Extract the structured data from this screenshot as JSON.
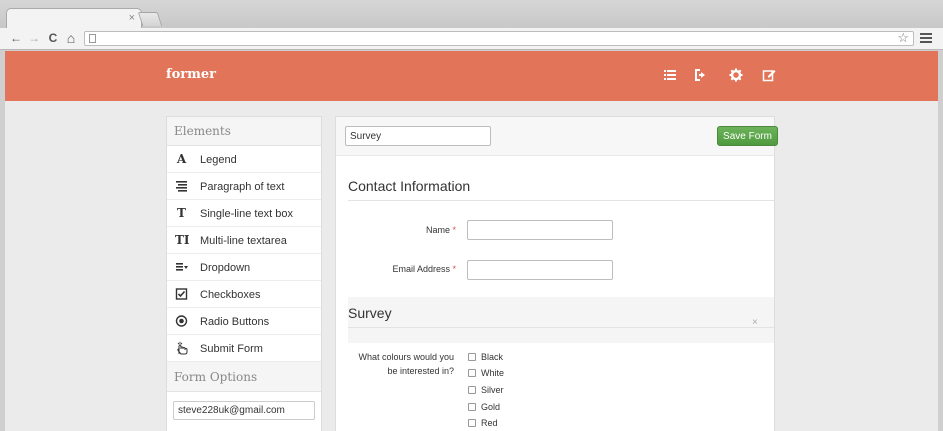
{
  "browser": {
    "tab_close": "×",
    "nav": {
      "back": "←",
      "forward": "→",
      "reload": "C",
      "home": "⌂"
    },
    "star": "☆"
  },
  "app": {
    "brand": "former",
    "header_icons": [
      "list-icon",
      "sign-out-icon",
      "gear-icon",
      "edit-icon"
    ],
    "accent_color": "#e27559"
  },
  "sidebar": {
    "elements_heading": "Elements",
    "items": [
      {
        "label": "Legend",
        "icon": "legend-icon",
        "glyph": "A"
      },
      {
        "label": "Paragraph of text",
        "icon": "paragraph-icon",
        "glyph": ""
      },
      {
        "label": "Single-line text box",
        "icon": "text-box-icon",
        "glyph": "T"
      },
      {
        "label": "Multi-line textarea",
        "icon": "textarea-icon",
        "glyph": "TI"
      },
      {
        "label": "Dropdown",
        "icon": "dropdown-icon",
        "glyph": ""
      },
      {
        "label": "Checkboxes",
        "icon": "checkbox-icon",
        "glyph": ""
      },
      {
        "label": "Radio Buttons",
        "icon": "radio-icon",
        "glyph": ""
      },
      {
        "label": "Submit Form",
        "icon": "hand-pointer-icon",
        "glyph": ""
      }
    ],
    "options_heading": "Form Options",
    "email_value": "steve228uk@gmail.com"
  },
  "form": {
    "name_value": "Survey",
    "save_label": "Save Form",
    "section1_title": "Contact Information",
    "name_label": "Name",
    "email_label": "Email Address",
    "required_marker": "*",
    "section2_title": "Survey",
    "section2_close": "×",
    "question_label": "What colours would you be interested in?",
    "options": [
      "Black",
      "White",
      "Silver",
      "Gold",
      "Red"
    ]
  }
}
